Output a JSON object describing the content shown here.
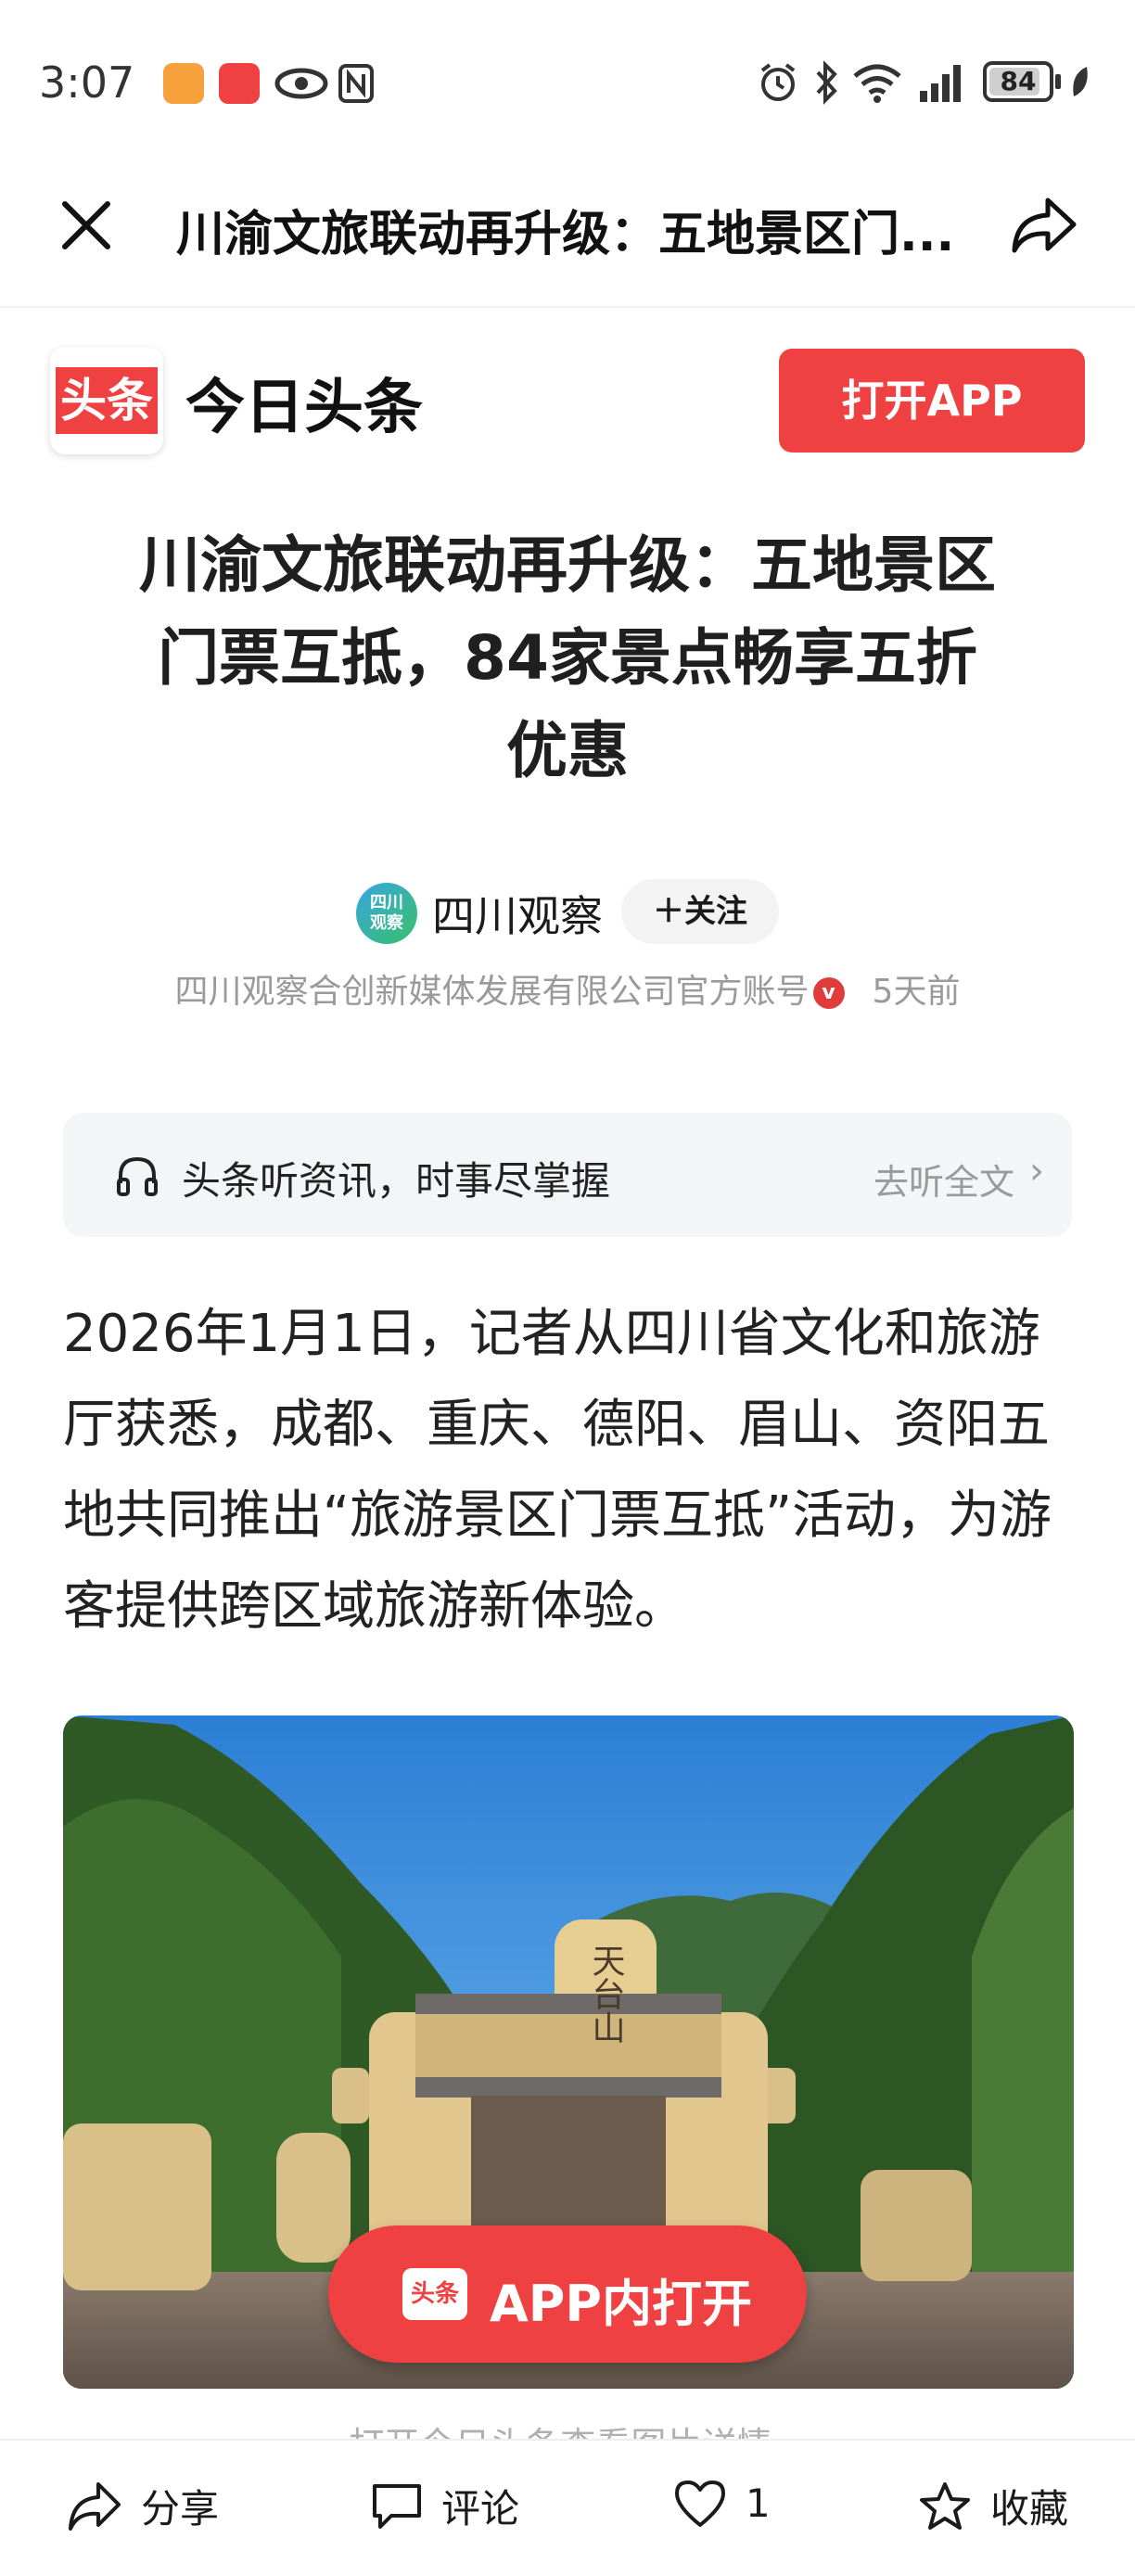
{
  "status_bar": {
    "time": "3:07",
    "battery": "84"
  },
  "title_bar": {
    "title": "川渝文旅联动再升级：五地景区门..."
  },
  "brand": {
    "logo_text": "头条",
    "name": "今日头条",
    "open_app_label": "打开APP"
  },
  "article": {
    "headline_lines": [
      "川渝文旅联动再升级：五地景区",
      "门票互抵，84家景点畅享五折",
      "优惠"
    ],
    "author": {
      "avatar_text": "四川\n观察",
      "name": "四川观察",
      "follow_label": "＋关注",
      "org": "四川观察合创新媒体发展有限公司官方账号",
      "verified_mark": "v",
      "time": "5天前"
    },
    "listen": {
      "text": "头条听资讯，时事尽掌握",
      "link": "去听全文"
    },
    "paragraph": "2026年1月1日，记者从四川省文化和旅游厅获悉，成都、重庆、德阳、眉山、资阳五地共同推出“旅游景区门票互抵”活动，为游客提供跨区域旅游新体验。",
    "image": {
      "gate_text": "天台山",
      "app_open_logo": "头条",
      "app_open_label": "APP内打开",
      "caption": "打开今日头条查看图片详情›"
    }
  },
  "bottom_bar": {
    "share": "分享",
    "comment": "评论",
    "like_count": "1",
    "favorite": "收藏"
  },
  "colors": {
    "brand_red": "#f04142",
    "muted_text": "#9a9a9a"
  }
}
